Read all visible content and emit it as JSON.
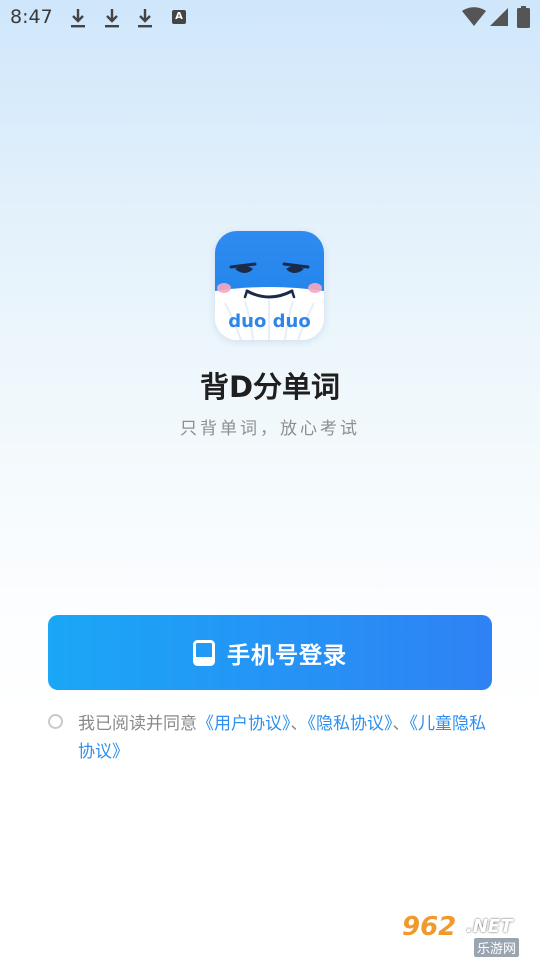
{
  "status_bar": {
    "time": "8:47",
    "icons": [
      "download-icon",
      "download-icon",
      "download-icon",
      "font-icon",
      "wifi-icon",
      "cellular-icon",
      "battery-icon"
    ],
    "font_icon_text": "A"
  },
  "app": {
    "logo_text": "duo duo",
    "title": "背D分单词",
    "subtitle": "只背单词，放心考试"
  },
  "login": {
    "button_label": "手机号登录",
    "icon": "phone-icon"
  },
  "agreement": {
    "prefix": "我已阅读并同意",
    "user_agreement": "《用户协议》",
    "sep1": "、",
    "privacy_agreement": "《隐私协议》",
    "sep2": "、",
    "child_privacy_agreement": "《儿童隐私协议》"
  },
  "watermark": {
    "number": "962",
    "suffix": ".NET",
    "site": "乐游网"
  },
  "colors": {
    "accent": "#2d8ff0",
    "button_start": "#1aa7f7",
    "button_end": "#2f82f4"
  }
}
